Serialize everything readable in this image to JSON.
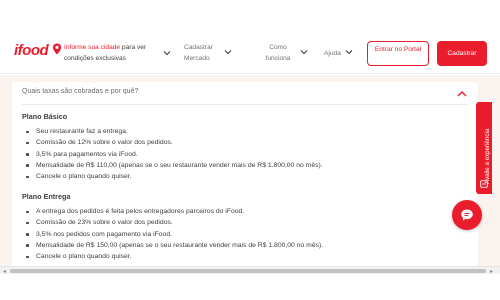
{
  "header": {
    "logo_text": "ifood",
    "location": {
      "highlight": "Informe sua cidade",
      "rest": " para ver condições exclusivas"
    },
    "nav": [
      {
        "label": "Cadastrar Mercado"
      },
      {
        "label": "Como funciona"
      },
      {
        "label": "Ajuda"
      }
    ],
    "login_button": "Entrar no Portal",
    "signup_button": "Cadastrar"
  },
  "faq": {
    "question": "Quais taxas são cobradas e por quê?",
    "plans": [
      {
        "title": "Plano Básico",
        "items": [
          "Seu restaurante faz a entrega.",
          "Comissão de 12% sobre o valor dos pedidos.",
          "3,5% para pagamentos via iFood.",
          "Mensalidade de R$ 110,00 (apenas se o seu restaurante vender mais de R$ 1.800,00 no mês).",
          "Cancele o plano quando quiser."
        ]
      },
      {
        "title": "Plano Entrega",
        "items": [
          "A entrega dos pedidos é feita pelos entregadores parceiros do iFood.",
          "Comissão de 23% sobre o valor dos pedidos.",
          "3,5% nos pedidos com pagamento via iFood.",
          "Mensalidade de R$ 150,00 (apenas se o seu restaurante vender mais de R$ 1.800,00 no mês).",
          "Cancele o plano quando quiser."
        ]
      }
    ]
  },
  "side_tab": {
    "label": "Avalie a experiência"
  },
  "icons": {
    "pin": "map-pin-icon",
    "chevron": "chevron-down-icon",
    "collapse": "chevron-up-icon",
    "chat": "chat-bubble-icon"
  },
  "colors": {
    "brand_red": "#ea1d2c",
    "page_background": "#fbf3ed",
    "text": "#3f3e3e"
  }
}
